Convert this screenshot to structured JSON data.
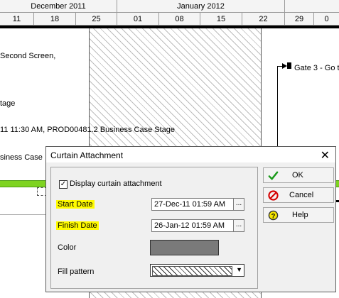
{
  "timescale": {
    "months": [
      "December 2011",
      "January 2012"
    ],
    "days": [
      "11",
      "18",
      "25",
      "01",
      "08",
      "15",
      "22",
      "29",
      "0"
    ]
  },
  "gantt": {
    "tasks": [
      "Second Screen,",
      "tage",
      "11 11:30 AM, PROD00481.2  Business Case Stage",
      "siness Case",
      "Gate 3 - Go to"
    ]
  },
  "dialog": {
    "title": "Curtain Attachment",
    "close_glyph": "✕",
    "display_label": "Display curtain attachment",
    "display_checked": true,
    "start_label": "Start Date",
    "start_value": "27-Dec-11 01:59 AM",
    "finish_label": "Finish Date",
    "finish_value": "26-Jan-12 01:59 AM",
    "color_label": "Color",
    "color_value": "#7a7a7a",
    "fill_label": "Fill pattern",
    "ellipsis": "...",
    "buttons": {
      "ok": "OK",
      "cancel": "Cancel",
      "help": "Help"
    }
  },
  "colors": {
    "highlight": "#fffb00",
    "green_bar": "#7ed321"
  }
}
